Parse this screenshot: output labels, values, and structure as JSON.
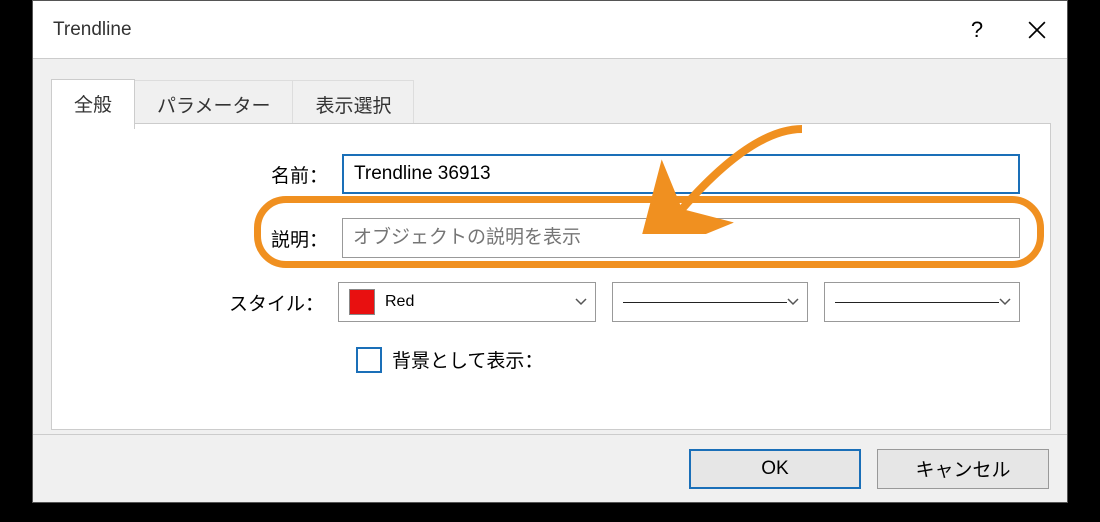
{
  "window": {
    "title": "Trendline"
  },
  "tabs": [
    {
      "label": "全般",
      "active": true
    },
    {
      "label": "パラメーター",
      "active": false
    },
    {
      "label": "表示選択",
      "active": false
    }
  ],
  "form": {
    "name_label": "名前：",
    "name_value": "Trendline 36913",
    "desc_label": "説明：",
    "desc_placeholder": "オブジェクトの説明を表示",
    "desc_value": "",
    "style_label": "スタイル：",
    "color_name": "Red",
    "color_hex": "#e81010",
    "bg_checkbox_label": "背景として表示："
  },
  "buttons": {
    "ok": "OK",
    "cancel": "キャンセル"
  }
}
